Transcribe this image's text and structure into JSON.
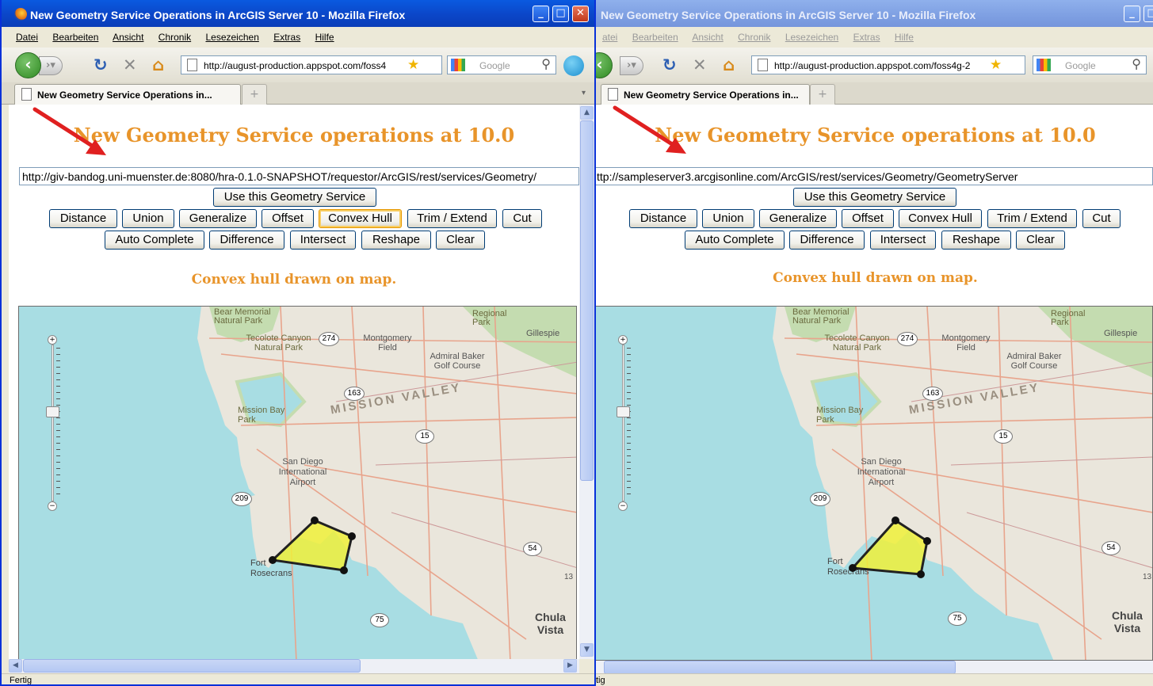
{
  "left": {
    "title": "New Geometry Service Operations in ArcGIS Server 10 - Mozilla Firefox",
    "menu": [
      "Datei",
      "Bearbeiten",
      "Ansicht",
      "Chronik",
      "Lesezeichen",
      "Extras",
      "Hilfe"
    ],
    "url": "http://august-production.appspot.com/foss4",
    "search_placeholder": "Google",
    "tab_label": "New Geometry Service Operations in...",
    "heading": "New Geometry Service operations at 10.0",
    "service_url": "http://giv-bandog.uni-muenster.de:8080/hra-0.1.0-SNAPSHOT/requestor/ArcGIS/rest/services/Geometry/",
    "use_button": "Use this Geometry Service",
    "status_message": "Convex hull drawn on map.",
    "statusbar": "Fertig"
  },
  "right": {
    "title": "New Geometry Service Operations in ArcGIS Server 10 - Mozilla Firefox",
    "menu": [
      "atei",
      "Bearbeiten",
      "Ansicht",
      "Chronik",
      "Lesezeichen",
      "Extras",
      "Hilfe"
    ],
    "url": "http://august-production.appspot.com/foss4g-2",
    "search_placeholder": "Google",
    "tab_label": "New Geometry Service Operations in...",
    "heading": "New Geometry Service operations at 10.0",
    "service_url": "ttp://sampleserver3.arcgisonline.com/ArcGIS/rest/services/Geometry/GeometryServer",
    "use_button": "Use this Geometry Service",
    "status_message": "Convex hull drawn on map.",
    "statusbar": "tig"
  },
  "operations_row1": [
    "Distance",
    "Union",
    "Generalize",
    "Offset",
    "Convex Hull",
    "Trim / Extend",
    "Cut"
  ],
  "operations_row2": [
    "Auto Complete",
    "Difference",
    "Intersect",
    "Reshape",
    "Clear"
  ],
  "map_labels": {
    "bear_memorial": "Bear Memorial Natural Park",
    "regional_park": "Regional Park",
    "tecolote": "Tecolote Canyon Natural Park",
    "montgomery": "Montgomery Field",
    "admiral_baker": "Admiral Baker Golf Course",
    "gillespie": "Gillespie",
    "mission_bay": "Mission Bay Park",
    "mission_valley": "MISSION VALLEY",
    "airport": "San Diego International Airport",
    "fort_rosecrans": "Fort Rosecrans",
    "chula_vista": "Chula Vista",
    "routes": [
      "274",
      "163",
      "15",
      "209",
      "54",
      "75",
      "13"
    ]
  },
  "colors": {
    "heading": "#e8942a",
    "hull_fill": "#f0f03a",
    "water": "#a8dde3",
    "land": "#eae6dc",
    "park": "#c4dcb0",
    "annotation_arrow": "#e02020"
  },
  "icons": [
    "firefox-icon",
    "back-icon",
    "forward-icon",
    "reload-icon",
    "stop-icon",
    "home-icon",
    "page-icon",
    "bookmark-star-icon",
    "google-icon",
    "search-magnifier-icon",
    "zoom-in-icon",
    "zoom-out-icon"
  ]
}
